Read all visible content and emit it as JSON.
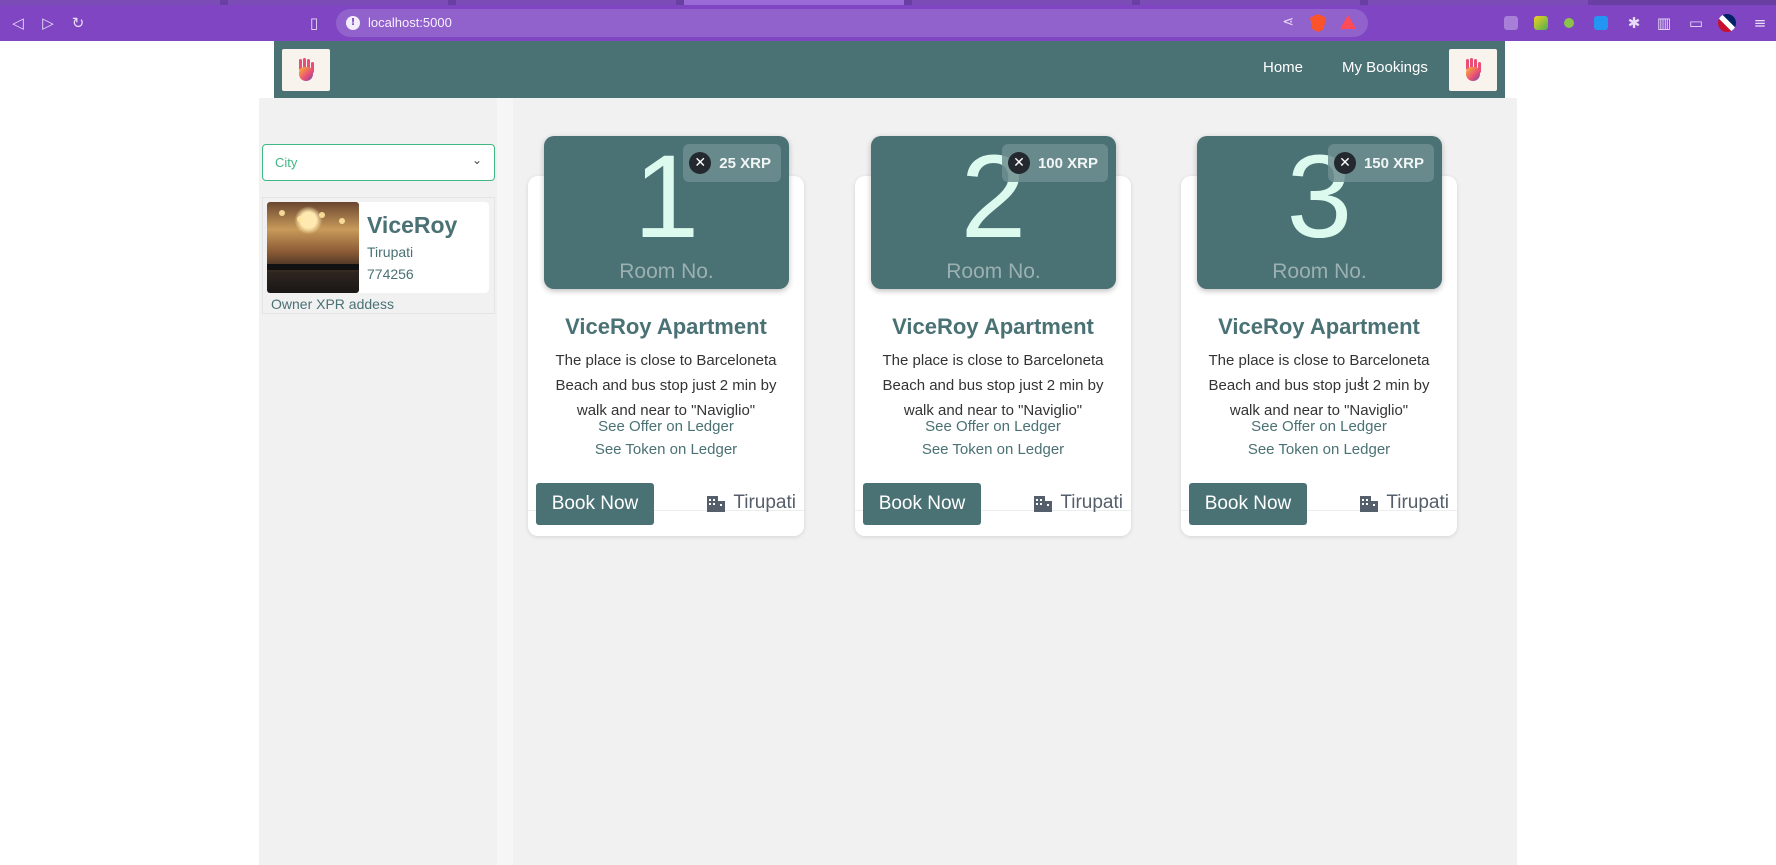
{
  "browser": {
    "url": "localhost:5000",
    "icons": [
      "back-icon",
      "forward-icon",
      "reload-icon",
      "bookmark-icon",
      "site-info-icon",
      "share-icon",
      "brave-shields-icon",
      "brave-rewards-icon",
      "extensions-icon",
      "sidebar-icon",
      "wallet-icon",
      "profile-icon",
      "menu-icon"
    ]
  },
  "navbar": {
    "links": [
      "Home",
      "My Bookings"
    ],
    "bg_color": "#4a7174"
  },
  "sidebar": {
    "city_select_placeholder": "City",
    "hotel": {
      "name": "ViceRoy",
      "city": "Tirupati",
      "pincode": "774256",
      "owner_label": "Owner XPR addess"
    }
  },
  "rooms": [
    {
      "number": "1",
      "number_label": "Room No.",
      "price": "25 XRP",
      "title": "ViceRoy Apartment",
      "description": "The place is close to Barceloneta Beach and bus stop just 2 min by walk and near to \"Naviglio\"",
      "offer_link": "See Offer on Ledger",
      "token_link": "See Token on Ledger",
      "book_label": "Book Now",
      "city": "Tirupati"
    },
    {
      "number": "2",
      "number_label": "Room No.",
      "price": "100 XRP",
      "title": "ViceRoy Apartment",
      "description": "The place is close to Barceloneta Beach and bus stop just 2 min by walk and near to \"Naviglio\"",
      "offer_link": "See Offer on Ledger",
      "token_link": "See Token on Ledger",
      "book_label": "Book Now",
      "city": "Tirupati"
    },
    {
      "number": "3",
      "number_label": "Room No.",
      "price": "150 XRP",
      "title": "ViceRoy Apartment",
      "description": "The place is close to Barceloneta Beach and bus stop just 2 min by walk and near to \"Naviglio\"",
      "offer_link": "See Offer on Ledger",
      "token_link": "See Token on Ledger",
      "book_label": "Book Now",
      "city": "Tirupati"
    }
  ]
}
